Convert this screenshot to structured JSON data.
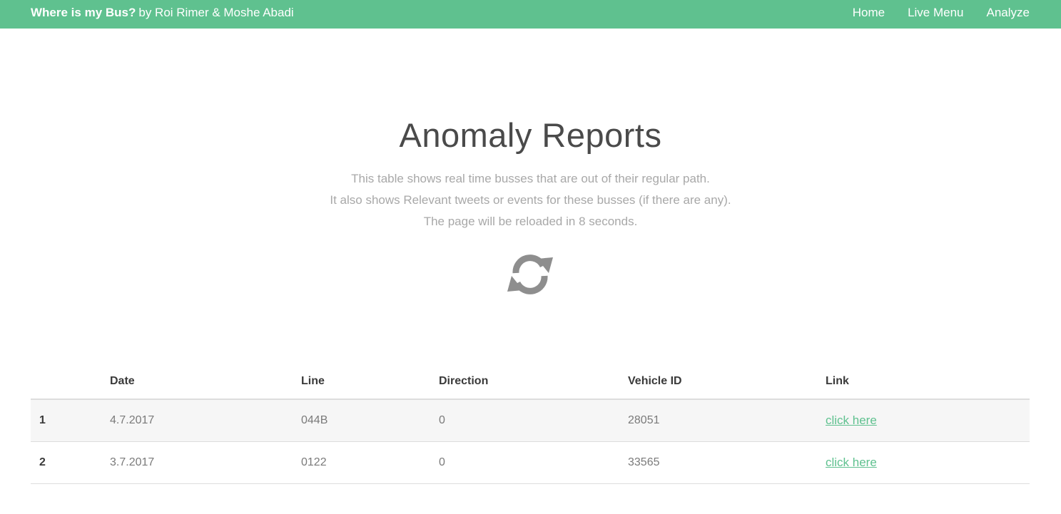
{
  "navbar": {
    "brand_strong": "Where is my Bus?",
    "brand_rest": "by Roi Rimer & Moshe Abadi",
    "links": [
      "Home",
      "Live Menu",
      "Analyze"
    ],
    "color": "#5fc18f"
  },
  "hero": {
    "title": "Anomaly Reports",
    "lines": [
      "This table shows real time busses that are out of their regular path.",
      "It also shows Relevant tweets or events for these busses (if there are any).",
      "The page will be reloaded in 8 seconds."
    ],
    "icon": "refresh-icon"
  },
  "table": {
    "headers": [
      "",
      "Date",
      "Line",
      "Direction",
      "Vehicle ID",
      "Link"
    ],
    "rows": [
      {
        "num": "1",
        "date": "4.7.2017",
        "line": "044B",
        "direction": "0",
        "vehicle_id": "28051",
        "link": "click here"
      },
      {
        "num": "2",
        "date": "3.7.2017",
        "line": "0122",
        "direction": "0",
        "vehicle_id": "33565",
        "link": "click here"
      }
    ]
  }
}
